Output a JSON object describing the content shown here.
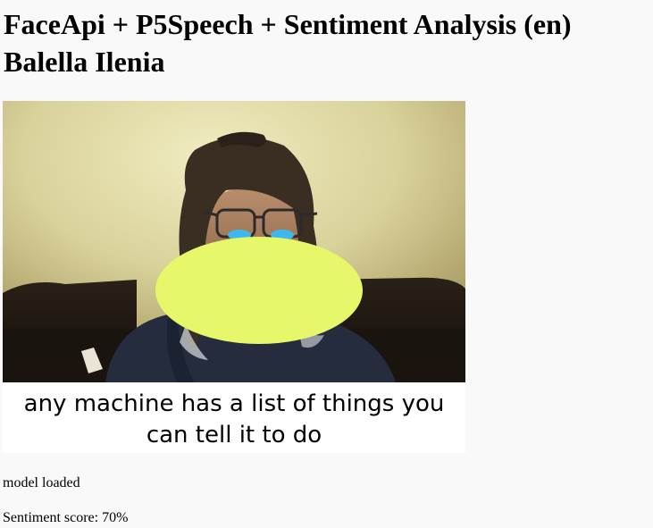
{
  "page": {
    "title": "FaceApi + P5Speech + Sentiment Analysis (en) Balella Ilenia"
  },
  "canvas": {
    "recognized_speech": "any machine has a list of things you can tell it to do",
    "face_overlay_color": "#e6f76a"
  },
  "status": {
    "model": "model loaded",
    "sentiment": "Sentiment score: 70%"
  }
}
